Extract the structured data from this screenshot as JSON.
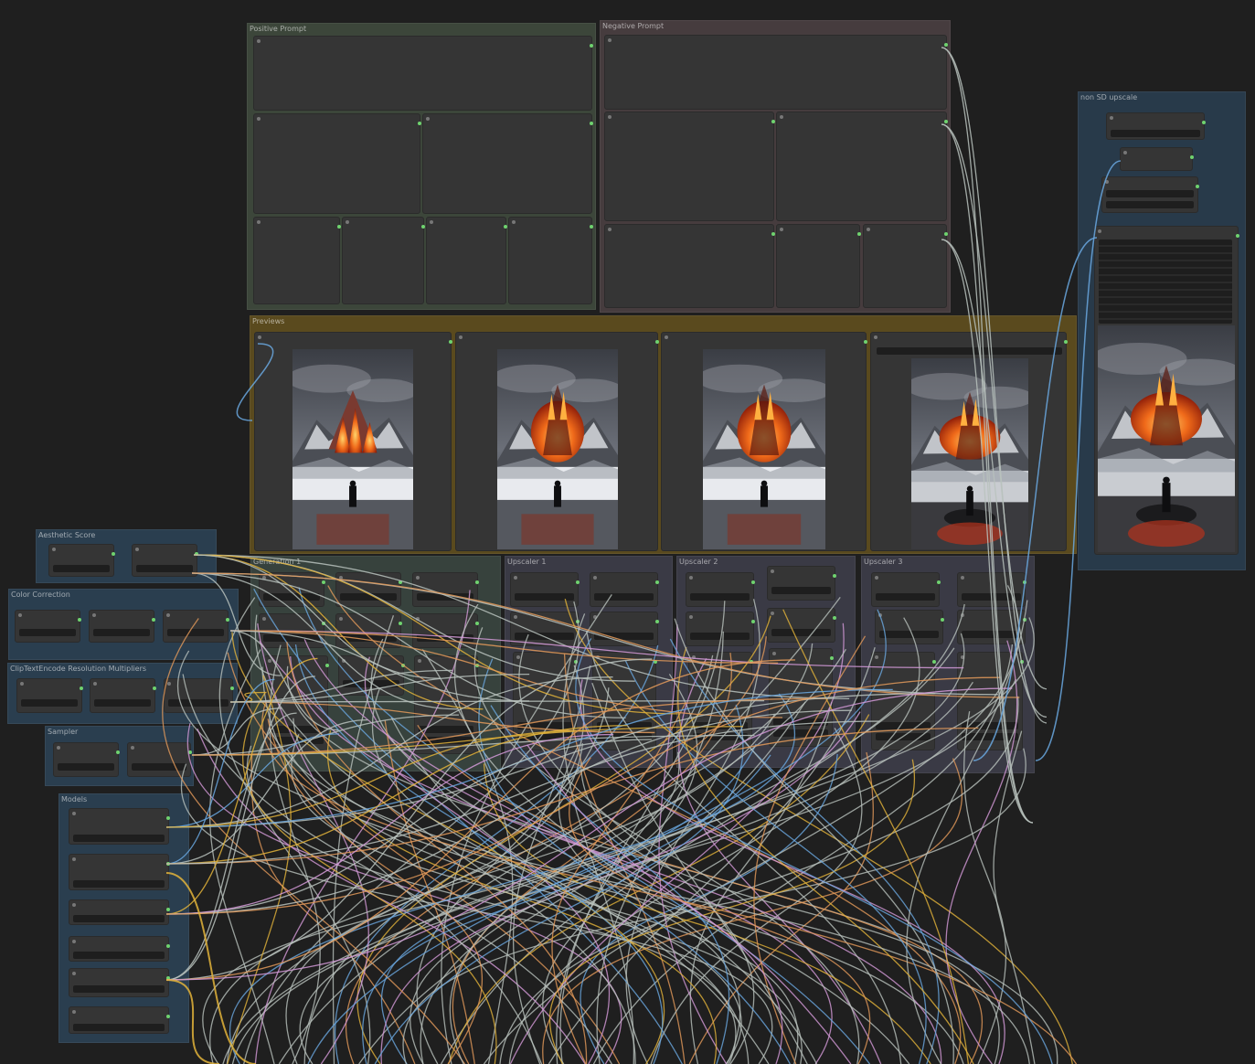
{
  "groups": {
    "positive_prompt": "Positive Prompt",
    "negative_prompt": "Negative Prompt",
    "previews": "Previews",
    "non_sd_upscale": "non SD upscale",
    "aesthetic_score": "Aesthetic Score",
    "color_correction": "Color Correction",
    "clip_multipliers": "ClipTextEncode Resolution Multipliers",
    "sampler": "Sampler",
    "models": "Models",
    "generation_1": "Generation 1",
    "upscaler_1": "Upscaler 1",
    "upscaler_2": "Upscaler 2",
    "upscaler_3": "Upscaler 3"
  },
  "colors": {
    "canvas": "#1f1f1f",
    "positive_group": "#3f4a3d",
    "negative_group": "#4a3f41",
    "previews_group": "#5a4a1e",
    "blue_group": "#2a3e4f",
    "generation_group": "#3a4540",
    "upscaler_group": "#3c3c48",
    "wire_gray": "#b9c2bd",
    "wire_yellow": "#e2b33a",
    "wire_pink": "#d49ad8",
    "wire_blue": "#6aa8e0",
    "wire_orange": "#e39a5a",
    "slot_green": "#6fd36f"
  },
  "previews": [
    {
      "name": "preview-image-generation-1"
    },
    {
      "name": "preview-image-upscaler-1"
    },
    {
      "name": "preview-image-upscaler-2"
    },
    {
      "name": "preview-image-upscaler-3"
    },
    {
      "name": "preview-image-non-sd-upscale"
    }
  ]
}
